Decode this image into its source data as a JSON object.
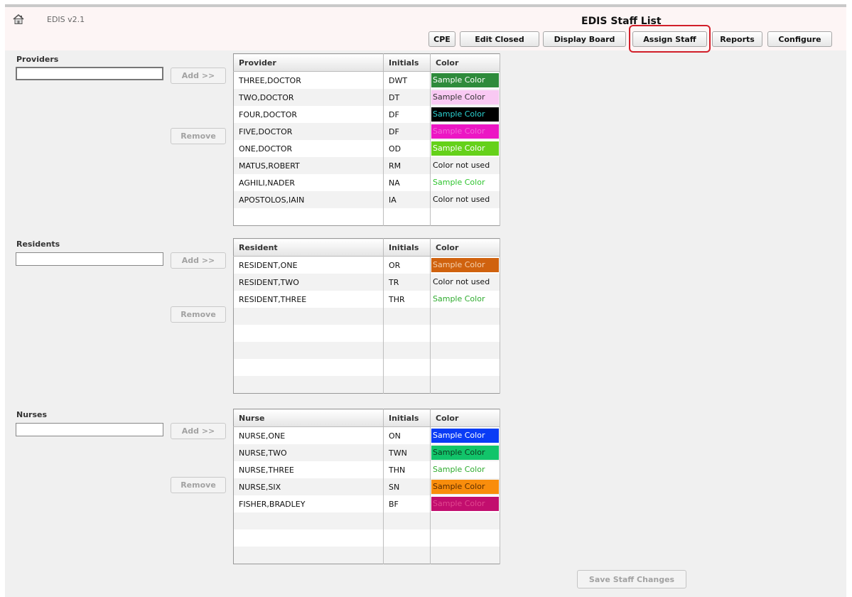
{
  "app": {
    "version": "EDIS v2.1",
    "title": "EDIS Staff List"
  },
  "nav": [
    {
      "label": "CPE",
      "active": false
    },
    {
      "label": "Edit Closed",
      "active": false
    },
    {
      "label": "Display Board",
      "active": false
    },
    {
      "label": "Assign Staff",
      "active": true
    },
    {
      "label": "Reports",
      "active": false
    },
    {
      "label": "Configure",
      "active": false
    }
  ],
  "providers": {
    "label": "Providers",
    "input_value": "",
    "add_label": "Add >>",
    "remove_label": "Remove",
    "columns": [
      "Provider",
      "Initials",
      "Color"
    ],
    "rows": [
      {
        "name": "THREE,DOCTOR",
        "initials": "DWT",
        "color": "Sample Color",
        "bg": "#2e8b3b",
        "fg": "#ffffff"
      },
      {
        "name": "TWO,DOCTOR",
        "initials": "DT",
        "color": "Sample Color",
        "bg": "#f9c9f3",
        "fg": "#333333"
      },
      {
        "name": "FOUR,DOCTOR",
        "initials": "DF",
        "color": "Sample Color",
        "bg": "#000000",
        "fg": "#2cd4d4"
      },
      {
        "name": "FIVE,DOCTOR",
        "initials": "DF",
        "color": "Sample Color",
        "bg": "#ec16c4",
        "fg": "#f06bd8"
      },
      {
        "name": "ONE,DOCTOR",
        "initials": "OD",
        "color": "Sample Color",
        "bg": "#65d11a",
        "fg": "#ffffff"
      },
      {
        "name": "MATUS,ROBERT",
        "initials": "RM",
        "color": "Color not used",
        "bg": "",
        "fg": "#111111"
      },
      {
        "name": "AGHILI,NADER",
        "initials": "NA",
        "color": "Sample Color",
        "bg": "",
        "fg": "#2ec42e"
      },
      {
        "name": "APOSTOLOS,IAIN",
        "initials": "IA",
        "color": "Color not used",
        "bg": "",
        "fg": "#111111"
      }
    ],
    "empty_rows": 1
  },
  "residents": {
    "label": "Residents",
    "input_value": "",
    "add_label": "Add >>",
    "remove_label": "Remove",
    "columns": [
      "Resident",
      "Initials",
      "Color"
    ],
    "rows": [
      {
        "name": "RESIDENT,ONE",
        "initials": "OR",
        "color": "Sample Color",
        "bg": "#d0620e",
        "fg": "#f5d2b0"
      },
      {
        "name": "RESIDENT,TWO",
        "initials": "TR",
        "color": "Color not used",
        "bg": "",
        "fg": "#111111"
      },
      {
        "name": "RESIDENT,THREE",
        "initials": "THR",
        "color": "Sample Color",
        "bg": "",
        "fg": "#2eab2e"
      }
    ],
    "empty_rows": 5
  },
  "nurses": {
    "label": "Nurses",
    "input_value": "",
    "add_label": "Add >>",
    "remove_label": "Remove",
    "columns": [
      "Nurse",
      "Initials",
      "Color"
    ],
    "rows": [
      {
        "name": "NURSE,ONE",
        "initials": "ON",
        "color": "Sample Color",
        "bg": "#0a3cf5",
        "fg": "#ffffff"
      },
      {
        "name": "NURSE,TWO",
        "initials": "TWN",
        "color": "Sample Color",
        "bg": "#12c46a",
        "fg": "#0c3a1e"
      },
      {
        "name": "NURSE,THREE",
        "initials": "THN",
        "color": "Sample Color",
        "bg": "",
        "fg": "#2eab2e"
      },
      {
        "name": "NURSE,SIX",
        "initials": "SN",
        "color": "Sample Color",
        "bg": "#f98d0c",
        "fg": "#5a2c00"
      },
      {
        "name": "FISHER,BRADLEY",
        "initials": "BF",
        "color": "Sample Color",
        "bg": "#c20e6e",
        "fg": "#e0488f"
      }
    ],
    "empty_rows": 3
  },
  "save_label": "Save Staff Changes",
  "colors": {
    "highlight": "#d21f2a",
    "header_bg": "#fdf5f5",
    "panel_bg": "#f0f0f0"
  }
}
